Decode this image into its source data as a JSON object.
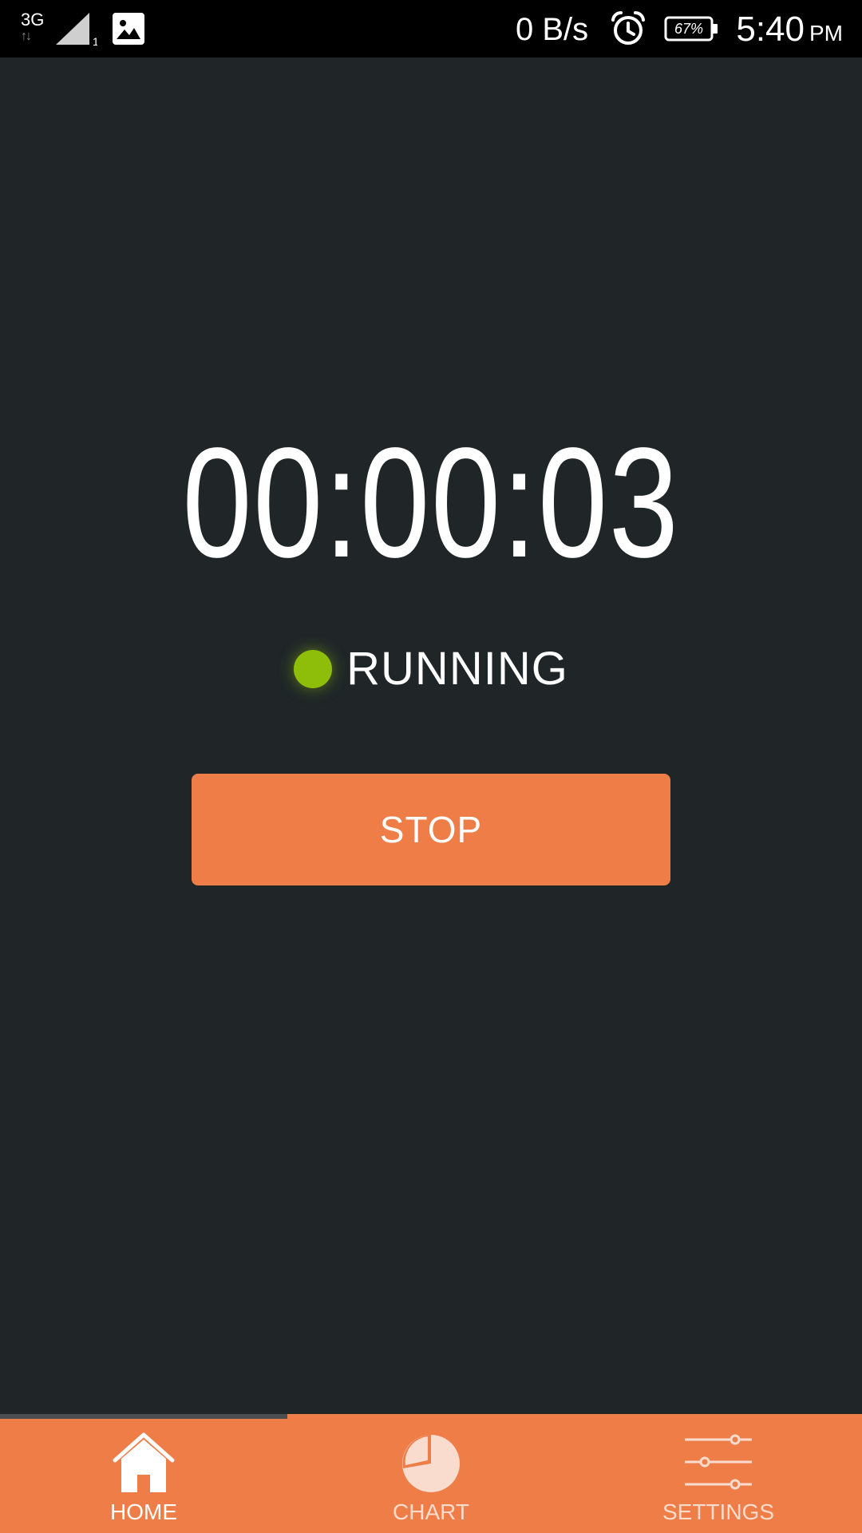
{
  "status_bar": {
    "network_type": "3G",
    "network_arrows": "↑↓",
    "sim_slot": "1",
    "net_speed": "0 B/s",
    "battery": "67%",
    "time": "5:40",
    "ampm": "PM",
    "icons": [
      "signal-icon",
      "image-icon",
      "alarm-icon",
      "battery-icon"
    ]
  },
  "timer": {
    "elapsed": "00:00:03"
  },
  "status": {
    "label": "RUNNING",
    "indicator_color": "#8ebd0a"
  },
  "actions": {
    "stop_label": "STOP"
  },
  "bottom_nav": {
    "tabs": [
      {
        "label": "HOME",
        "icon": "home-icon",
        "active": true
      },
      {
        "label": "CHART",
        "icon": "pie-chart-icon",
        "active": false
      },
      {
        "label": "SETTINGS",
        "icon": "sliders-icon",
        "active": false
      }
    ]
  },
  "colors": {
    "background": "#202628",
    "accent": "#ee7d47",
    "status_bar": "#000000",
    "text": "#ffffff"
  }
}
